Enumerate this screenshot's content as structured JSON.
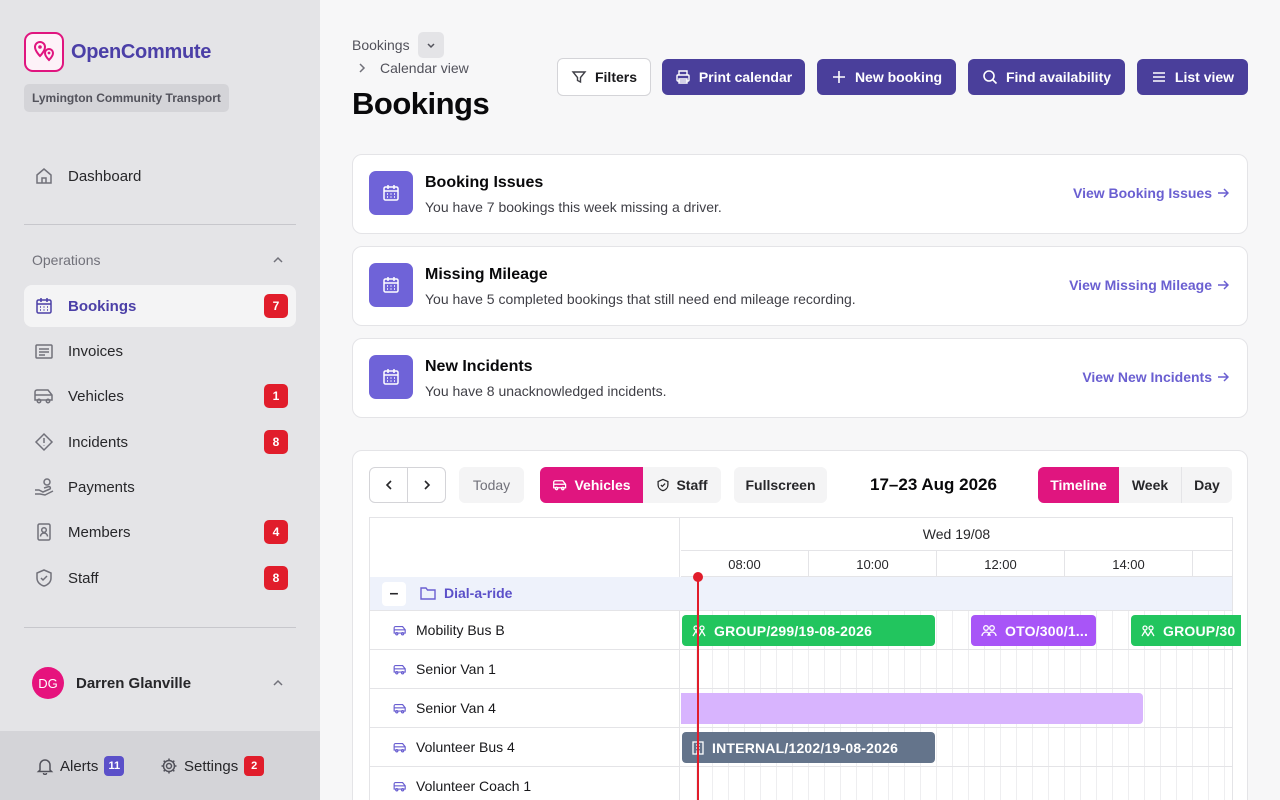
{
  "brand": {
    "name": "OpenCommute",
    "org": "Lymington Community Transport",
    "accent": "#e0157f",
    "primary": "#4a3f9b"
  },
  "sidebar": {
    "dashboard": "Dashboard",
    "section": "Operations",
    "items": [
      {
        "label": "Bookings",
        "icon": "calendar-icon",
        "count": "7",
        "active": true
      },
      {
        "label": "Invoices",
        "icon": "receipt-icon",
        "count": ""
      },
      {
        "label": "Vehicles",
        "icon": "bus-icon",
        "count": "1"
      },
      {
        "label": "Incidents",
        "icon": "warning-icon",
        "count": "8"
      },
      {
        "label": "Payments",
        "icon": "hand-coins-icon",
        "count": ""
      },
      {
        "label": "Members",
        "icon": "id-card-icon",
        "count": "4"
      },
      {
        "label": "Staff",
        "icon": "shield-icon",
        "count": "8"
      }
    ],
    "user": {
      "initials": "DG",
      "name": "Darren Glanville"
    },
    "footer": {
      "alerts_label": "Alerts",
      "alerts_count": "11",
      "settings_label": "Settings",
      "settings_count": "2"
    }
  },
  "header": {
    "breadcrumb_root": "Bookings",
    "breadcrumb_child": "Calendar view",
    "title": "Bookings",
    "buttons": {
      "filters": "Filters",
      "print": "Print calendar",
      "new": "New booking",
      "find": "Find availability",
      "list": "List view"
    }
  },
  "cards": [
    {
      "title": "Booking Issues",
      "desc": "You have 7 bookings this week missing a driver.",
      "link": "View Booking Issues"
    },
    {
      "title": "Missing Mileage",
      "desc": "You have 5 completed bookings that still need end mileage recording.",
      "link": "View Missing Mileage"
    },
    {
      "title": "New Incidents",
      "desc": "You have 8 unacknowledged incidents.",
      "link": "View New Incidents"
    }
  ],
  "calendar": {
    "today": "Today",
    "resource_tabs": [
      "Vehicles",
      "Staff"
    ],
    "fullscreen": "Fullscreen",
    "range": "17–23 Aug 2026",
    "views": [
      "Timeline",
      "Week",
      "Day"
    ],
    "day": "Wed 19/08",
    "hours": [
      "08:00",
      "10:00",
      "12:00",
      "14:00"
    ],
    "group": "Dial-a-ride",
    "resources": [
      "Mobility Bus B",
      "Senior Van 1",
      "Senior Van 4",
      "Volunteer Bus 4",
      "Volunteer Coach 1"
    ],
    "events": {
      "e1": "GROUP/299/19-08-2026",
      "e2": "OTO/300/1...",
      "e3": "GROUP/30",
      "e4": "INTERNAL/1202/19-08-2026"
    }
  }
}
